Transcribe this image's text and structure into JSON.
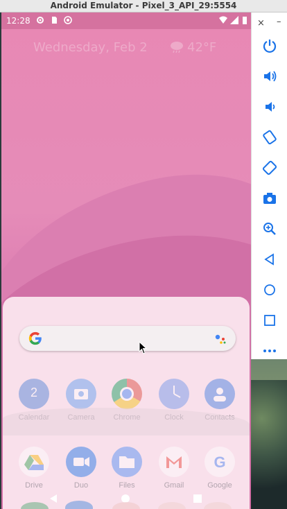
{
  "window": {
    "title": "Android Emulator - Pixel_3_API_29:5554"
  },
  "statusbar": {
    "time": "12:28",
    "icons": [
      "settings-icon",
      "sd-card-icon",
      "sync-icon",
      "wifi-icon",
      "signal-icon",
      "battery-icon"
    ]
  },
  "glance": {
    "date": "Wednesday, Feb 2",
    "weather_icon": "cloud-rain-icon",
    "temp": "42°F"
  },
  "search": {
    "logo": "google-g-icon",
    "assistant": "assistant-dots-icon"
  },
  "apps_row1": [
    {
      "label": "Calendar",
      "icon": "calendar-icon",
      "badge": "2"
    },
    {
      "label": "Camera",
      "icon": "camera-icon"
    },
    {
      "label": "Chrome",
      "icon": "chrome-icon"
    },
    {
      "label": "Clock",
      "icon": "clock-icon"
    },
    {
      "label": "Contacts",
      "icon": "contacts-icon"
    }
  ],
  "apps_row2": [
    {
      "label": "Drive",
      "icon": "drive-icon"
    },
    {
      "label": "Duo",
      "icon": "duo-icon"
    },
    {
      "label": "Files",
      "icon": "files-icon"
    },
    {
      "label": "Gmail",
      "icon": "gmail-icon"
    },
    {
      "label": "Google",
      "icon": "google-icon"
    }
  ],
  "toolbar": {
    "close": "×",
    "minimize": "–",
    "buttons": [
      "power-icon",
      "volume-up-icon",
      "volume-down-icon",
      "rotate-left-icon",
      "rotate-right-icon",
      "screenshot-icon",
      "zoom-icon",
      "back-icon",
      "home-icon",
      "overview-icon",
      "more-icon"
    ]
  },
  "colors": {
    "wallpaper": "#e58cb8",
    "drawer": "#fce8f0",
    "toolbar_icon": "#1a73e8"
  }
}
